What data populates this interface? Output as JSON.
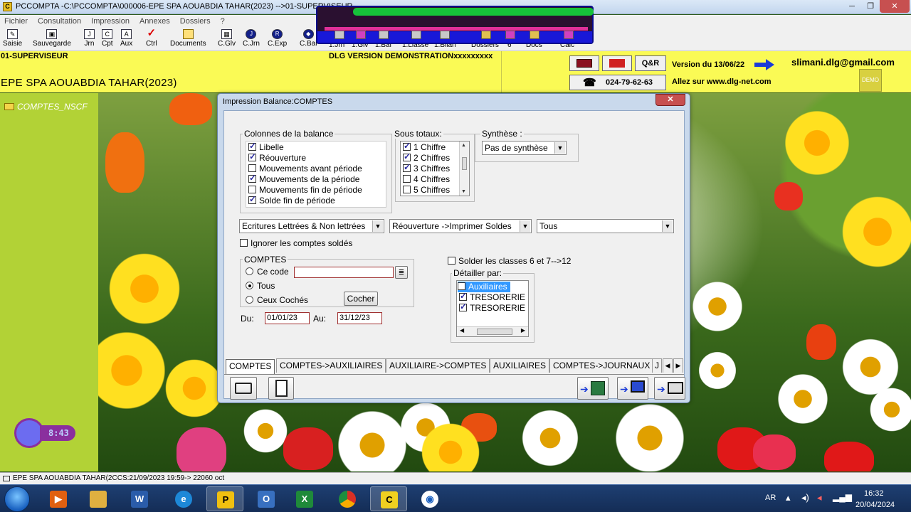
{
  "window": {
    "title": "PCCOMPTA -C:\\PCCOMPTA\\000006-EPE SPA  AOUABDIA TAHAR(2023) -->01-SUPERVISEUR",
    "controls": [
      "─",
      "❐",
      "✕"
    ]
  },
  "menu": [
    "Fichier",
    "Consultation",
    "Impression",
    "Annexes",
    "Dossiers",
    "?"
  ],
  "toolbar": [
    {
      "label": "Saisie",
      "icon": "pencil-icon"
    },
    {
      "label": "Sauvegarde",
      "icon": "save-icon"
    },
    {
      "label": "Jrn",
      "icon": "journal-icon"
    },
    {
      "label": "Cpt",
      "icon": "account-icon"
    },
    {
      "label": "Aux",
      "icon": "auxiliary-icon"
    },
    {
      "label": "Ctrl",
      "icon": "check-icon"
    },
    {
      "label": "Documents",
      "icon": "folder-icon"
    },
    {
      "label": "C.Glv",
      "icon": "grid-icon"
    },
    {
      "label": "C.Jrn",
      "icon": "journal-circle-icon"
    },
    {
      "label": "C.Exp",
      "icon": "export-circle-icon"
    },
    {
      "label": "C.Bal",
      "icon": "balance-diamond-icon"
    },
    {
      "label": "1.Jrn",
      "icon": ""
    },
    {
      "label": "1.Glv",
      "icon": ""
    },
    {
      "label": "1.Bal",
      "icon": ""
    },
    {
      "label": "1.Liasse",
      "icon": ""
    },
    {
      "label": "1.Bilan",
      "icon": ""
    },
    {
      "label": "Dossiers",
      "icon": ""
    },
    {
      "label": "6",
      "icon": ""
    },
    {
      "label": "Docs",
      "icon": ""
    },
    {
      "label": "Calc",
      "icon": "calculator-icon"
    }
  ],
  "header": {
    "user": "01-SUPERVISEUR",
    "company": "EPE SPA  AOUABDIA TAHAR(2023)",
    "demo": "DLG VERSION DEMONSTRATIONxxxxxxxxx",
    "qa_label": "Q&R",
    "phone": "024-79-62-63",
    "version": "Version du 13/06/22",
    "site": "Allez sur  www.dlg-net.com",
    "email": "slimani.dlg@gmail.com",
    "demo_logo": "DEMO"
  },
  "sidebar": {
    "item": "COMPTES_NSCF",
    "clock": "8:43"
  },
  "dialog": {
    "title": "Impression Balance:COMPTES",
    "close": "✕",
    "colonnes": {
      "label": "Colonnes de la balance",
      "items": [
        {
          "label": "Libelle",
          "checked": true
        },
        {
          "label": "Réouverture",
          "checked": true
        },
        {
          "label": "Mouvements avant période",
          "checked": false
        },
        {
          "label": "Mouvements de la période",
          "checked": true
        },
        {
          "label": "Mouvements fin de période",
          "checked": false
        },
        {
          "label": "Solde fin de période",
          "checked": true
        }
      ]
    },
    "sous_totaux": {
      "label": "Sous totaux:",
      "items": [
        {
          "label": "1  Chiffre",
          "checked": true
        },
        {
          "label": "2 Chiffres",
          "checked": true
        },
        {
          "label": "3 Chiffres",
          "checked": true
        },
        {
          "label": "4 Chiffres",
          "checked": false
        },
        {
          "label": "5 Chiffres",
          "checked": false
        }
      ]
    },
    "synthese": {
      "label": "Synthèse :",
      "value": "Pas de synthèse"
    },
    "combo1": "Ecritures Lettrées & Non lettrées",
    "combo2": "Réouverture ->Imprimer Soldes",
    "combo3": "Tous",
    "ignorer": {
      "label": "Ignorer les comptes soldés",
      "checked": false
    },
    "comptes": {
      "label": "COMPTES",
      "ce_code": "Ce code",
      "tous": "Tous",
      "ceux_coches": "Ceux Cochés",
      "cocher": "Cocher",
      "selected": "tous",
      "code_value": ""
    },
    "du": {
      "label": "Du:",
      "value": "01/01/23"
    },
    "au": {
      "label": "Au:",
      "value": "31/12/23"
    },
    "solder": {
      "label": "Solder les classes 6 et 7-->12",
      "checked": false
    },
    "detailler": {
      "label": "Détailler par:",
      "items": [
        {
          "label": "Auxiliaires",
          "checked": false,
          "selected": true
        },
        {
          "label": "TRESORERIE",
          "checked": true,
          "selected": false
        },
        {
          "label": "TRESORERIE",
          "checked": true,
          "selected": false
        }
      ]
    },
    "tabs": [
      "COMPTES",
      "COMPTES->AUXILIAIRES",
      "AUXILIAIRE->COMPTES",
      "AUXILIAIRES",
      "COMPTES->JOURNAUX",
      "J"
    ],
    "active_tab": 0
  },
  "statusbar": "EPE SPA  AOUABDIA TAHAR(2CCS:21/09/2023 19:59->   22060 oct",
  "taskbar": {
    "apps": [
      "media-player",
      "file-explorer",
      "word",
      "internet-explorer",
      "pccompta-p",
      "outlook",
      "excel",
      "chrome",
      "pccompta",
      "app-circle"
    ],
    "lang": "AR",
    "time": "16:32",
    "date": "20/04/2024"
  },
  "colors": {
    "header_yellow": "#fafa55",
    "sidebar_green": "#b2d236",
    "dialog_frame": "#c9d9ec",
    "close_red": "#c75050"
  }
}
